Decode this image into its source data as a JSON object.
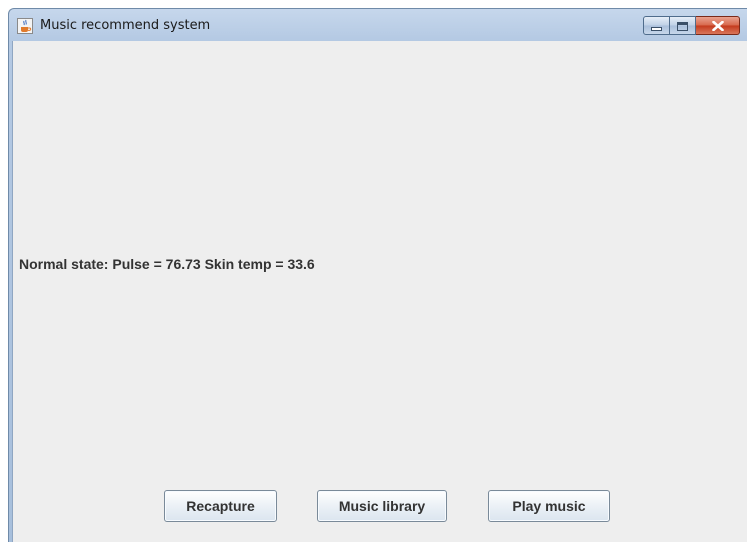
{
  "window": {
    "title": "Music recommend system",
    "app_icon": "java-cup-icon",
    "controls": [
      "minimize-icon",
      "maximize-icon",
      "close-icon"
    ]
  },
  "main": {
    "status_text": "Normal state: Pulse = 76.73 Skin temp = 33.6"
  },
  "buttons": {
    "recapture": "Recapture",
    "music_library": "Music library",
    "play_music": "Play music"
  },
  "colors": {
    "content_bg": "#eeeeee",
    "close_button": "#c4391c"
  }
}
